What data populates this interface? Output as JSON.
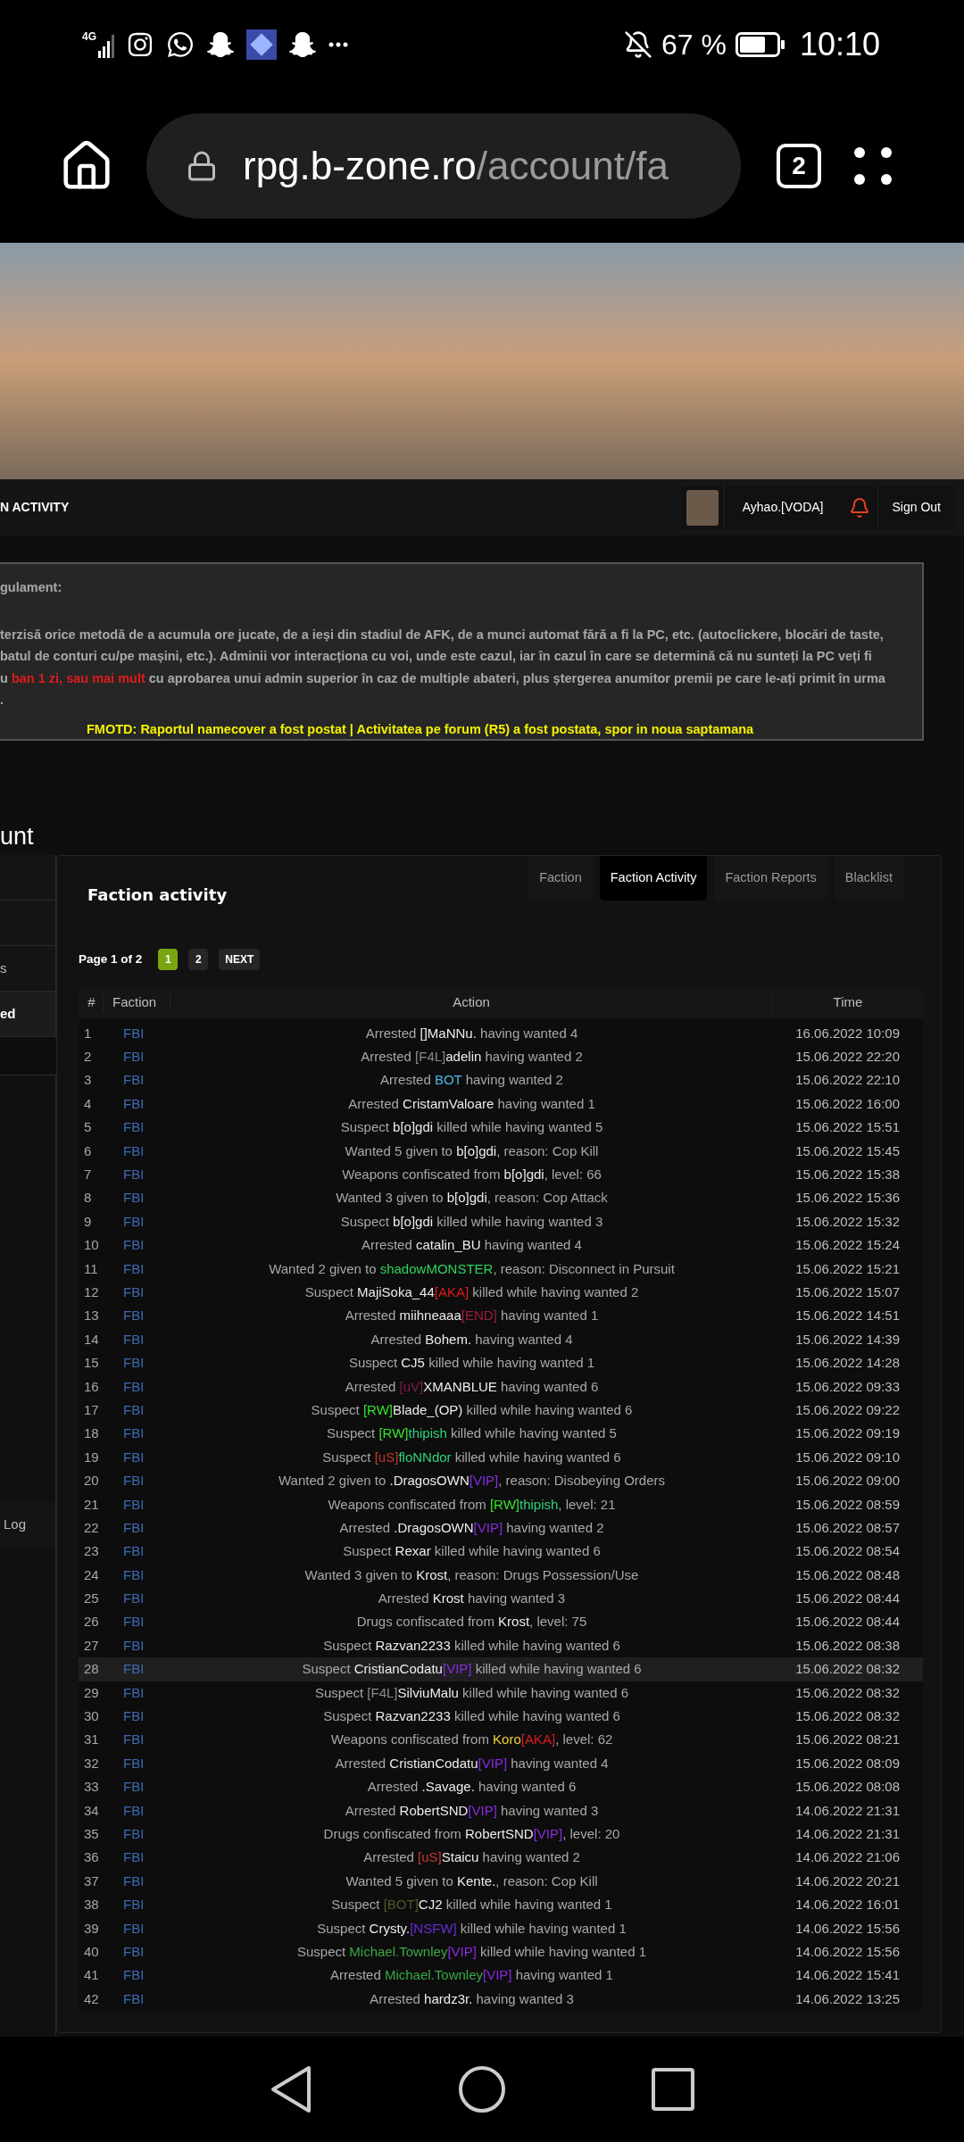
{
  "status_bar": {
    "network": "4G",
    "battery": "67 %",
    "time": "10:10"
  },
  "browser": {
    "url_host": "rpg.b-zone.ro",
    "url_path": "/account/fa",
    "tab_count": "2"
  },
  "nav": {
    "section": "N ACTIVITY",
    "user": "Ayhao.[VODA]",
    "sign_out": "Sign Out"
  },
  "rules": {
    "lines": [
      {
        "kind": "heading",
        "parts": [
          {
            "kind": "text",
            "text": "gulament:"
          }
        ]
      },
      {
        "kind": "body",
        "parts": [
          {
            "kind": "text",
            "text": "terzisă orice metodă de a acumula ore jucate, de a ieși din stadiul de AFK, de a munci automat fără a fi la PC, etc. (autoclickere, blocări de taste,"
          }
        ]
      },
      {
        "kind": "body",
        "parts": [
          {
            "kind": "text",
            "text": "batul de conturi cu/pe mașini, etc.). Adminii vor interacționa cu voi, unde este cazul, iar în cazul în care se determină că nu sunteți la PC veți fi"
          }
        ]
      },
      {
        "kind": "body",
        "parts": [
          {
            "kind": "text",
            "text": "u "
          },
          {
            "kind": "warning",
            "text": "ban 1 zi, sau mai mult"
          },
          {
            "kind": "text",
            "text": " cu aprobarea unui admin superior în caz de multiple abateri, plus ștergerea anumitor premii pe care le-ați primit în urma"
          }
        ]
      },
      {
        "kind": "body",
        "parts": [
          {
            "kind": "text",
            "text": "."
          }
        ]
      }
    ],
    "motd": "FMOTD: Raportul namecover a fost postat | Activitatea pe forum (R5) a fost postata, spor in noua saptamana"
  },
  "page_heading": "unt",
  "sidebar": {
    "items": [
      {
        "label": "s",
        "selected": false
      },
      {
        "label": "ed",
        "selected": true
      }
    ],
    "lower_items": [
      {
        "label": "Log",
        "selected": false
      }
    ]
  },
  "panel": {
    "title": "Faction activity",
    "tabs": [
      {
        "label": "Faction",
        "selected": false
      },
      {
        "label": "Faction Activity",
        "selected": true
      },
      {
        "label": "Faction Reports",
        "selected": false
      },
      {
        "label": "Blacklist",
        "selected": false
      }
    ],
    "pagination": {
      "label": "Page 1 of 2",
      "pages": [
        {
          "label": "1",
          "selected": true
        },
        {
          "label": "2",
          "selected": false
        }
      ],
      "next": "NEXT"
    },
    "table": {
      "columns": [
        "#",
        "Faction",
        "Action",
        "Time"
      ],
      "rows": [
        {
          "n": "1",
          "faction": "FBI",
          "time": "16.06.2022 10:09",
          "highlighted": false,
          "action": [
            {
              "kind": "text",
              "text": "Arrested "
            },
            {
              "kind": "name",
              "text": "[]MaNNu."
            },
            {
              "kind": "text",
              "text": " having wanted 4"
            }
          ]
        },
        {
          "n": "2",
          "faction": "FBI",
          "time": "15.06.2022 22:20",
          "highlighted": false,
          "action": [
            {
              "kind": "text",
              "text": "Arrested "
            },
            {
              "kind": "tag",
              "text": "[F4L]",
              "color": "#8a8a8a"
            },
            {
              "kind": "name",
              "text": "adelin"
            },
            {
              "kind": "text",
              "text": " having wanted 2"
            }
          ]
        },
        {
          "n": "3",
          "faction": "FBI",
          "time": "15.06.2022 22:10",
          "highlighted": false,
          "action": [
            {
              "kind": "text",
              "text": "Arrested "
            },
            {
              "kind": "tag",
              "text": "BOT",
              "color": "#4ab8e8"
            },
            {
              "kind": "text",
              "text": " having wanted 2"
            }
          ]
        },
        {
          "n": "4",
          "faction": "FBI",
          "time": "15.06.2022 16:00",
          "highlighted": false,
          "action": [
            {
              "kind": "text",
              "text": "Arrested "
            },
            {
              "kind": "name",
              "text": "CristamValoare"
            },
            {
              "kind": "text",
              "text": " having wanted 1"
            }
          ]
        },
        {
          "n": "5",
          "faction": "FBI",
          "time": "15.06.2022 15:51",
          "highlighted": false,
          "action": [
            {
              "kind": "text",
              "text": "Suspect "
            },
            {
              "kind": "name",
              "text": "b[o]gdi"
            },
            {
              "kind": "text",
              "text": " killed while having wanted 5"
            }
          ]
        },
        {
          "n": "6",
          "faction": "FBI",
          "time": "15.06.2022 15:45",
          "highlighted": false,
          "action": [
            {
              "kind": "text",
              "text": "Wanted 5 given to "
            },
            {
              "kind": "name",
              "text": "b[o]gdi"
            },
            {
              "kind": "text",
              "text": ", reason: Cop Kill"
            }
          ]
        },
        {
          "n": "7",
          "faction": "FBI",
          "time": "15.06.2022 15:38",
          "highlighted": false,
          "action": [
            {
              "kind": "text",
              "text": "Weapons confiscated from "
            },
            {
              "kind": "name",
              "text": "b[o]gdi"
            },
            {
              "kind": "text",
              "text": ", level: 66"
            }
          ]
        },
        {
          "n": "8",
          "faction": "FBI",
          "time": "15.06.2022 15:36",
          "highlighted": false,
          "action": [
            {
              "kind": "text",
              "text": "Wanted 3 given to "
            },
            {
              "kind": "name",
              "text": "b[o]gdi"
            },
            {
              "kind": "text",
              "text": ", reason: Cop Attack"
            }
          ]
        },
        {
          "n": "9",
          "faction": "FBI",
          "time": "15.06.2022 15:32",
          "highlighted": false,
          "action": [
            {
              "kind": "text",
              "text": "Suspect "
            },
            {
              "kind": "name",
              "text": "b[o]gdi"
            },
            {
              "kind": "text",
              "text": " killed while having wanted 3"
            }
          ]
        },
        {
          "n": "10",
          "faction": "FBI",
          "time": "15.06.2022 15:24",
          "highlighted": false,
          "action": [
            {
              "kind": "text",
              "text": "Arrested "
            },
            {
              "kind": "name",
              "text": "catalin_BU"
            },
            {
              "kind": "text",
              "text": " having wanted 4"
            }
          ]
        },
        {
          "n": "11",
          "faction": "FBI",
          "time": "15.06.2022 15:21",
          "highlighted": false,
          "action": [
            {
              "kind": "text",
              "text": "Wanted 2 given to "
            },
            {
              "kind": "tag",
              "text": "shadowMONSTER",
              "color": "#2fd45a"
            },
            {
              "kind": "text",
              "text": ", reason: Disconnect in Pursuit"
            }
          ]
        },
        {
          "n": "12",
          "faction": "FBI",
          "time": "15.06.2022 15:07",
          "highlighted": false,
          "action": [
            {
              "kind": "text",
              "text": "Suspect "
            },
            {
              "kind": "name",
              "text": "MajiSoka_44"
            },
            {
              "kind": "tag",
              "text": "[AKA]",
              "color": "#e01b1b"
            },
            {
              "kind": "text",
              "text": " killed while having wanted 2"
            }
          ]
        },
        {
          "n": "13",
          "faction": "FBI",
          "time": "15.06.2022 14:51",
          "highlighted": false,
          "action": [
            {
              "kind": "text",
              "text": "Arrested "
            },
            {
              "kind": "name",
              "text": "miihneaaa"
            },
            {
              "kind": "tag",
              "text": "[END]",
              "color": "#9c1f3c"
            },
            {
              "kind": "text",
              "text": " having wanted 1"
            }
          ]
        },
        {
          "n": "14",
          "faction": "FBI",
          "time": "15.06.2022 14:39",
          "highlighted": false,
          "action": [
            {
              "kind": "text",
              "text": "Arrested "
            },
            {
              "kind": "name",
              "text": "Bohem."
            },
            {
              "kind": "text",
              "text": " having wanted 4"
            }
          ]
        },
        {
          "n": "15",
          "faction": "FBI",
          "time": "15.06.2022 14:28",
          "highlighted": false,
          "action": [
            {
              "kind": "text",
              "text": "Suspect "
            },
            {
              "kind": "name",
              "text": "CJ5"
            },
            {
              "kind": "text",
              "text": " killed while having wanted 1"
            }
          ]
        },
        {
          "n": "16",
          "faction": "FBI",
          "time": "15.06.2022 09:33",
          "highlighted": false,
          "action": [
            {
              "kind": "text",
              "text": "Arrested "
            },
            {
              "kind": "tag",
              "text": "[uV]",
              "color": "#7d1f4c"
            },
            {
              "kind": "name",
              "text": "XMANBLUE"
            },
            {
              "kind": "text",
              "text": " having wanted 6"
            }
          ]
        },
        {
          "n": "17",
          "faction": "FBI",
          "time": "15.06.2022 09:22",
          "highlighted": false,
          "action": [
            {
              "kind": "text",
              "text": "Suspect "
            },
            {
              "kind": "tag",
              "text": "[RW]",
              "color": "#33e62b"
            },
            {
              "kind": "name",
              "text": "Blade_(OP)"
            },
            {
              "kind": "text",
              "text": " killed while having wanted 6"
            }
          ]
        },
        {
          "n": "18",
          "faction": "FBI",
          "time": "15.06.2022 09:19",
          "highlighted": false,
          "action": [
            {
              "kind": "text",
              "text": "Suspect "
            },
            {
              "kind": "tag",
              "text": "[RW]",
              "color": "#33e62b"
            },
            {
              "kind": "tag",
              "text": "thipish",
              "color": "#2fd47a"
            },
            {
              "kind": "text",
              "text": " killed while having wanted 5"
            }
          ]
        },
        {
          "n": "19",
          "faction": "FBI",
          "time": "15.06.2022 09:10",
          "highlighted": false,
          "action": [
            {
              "kind": "text",
              "text": "Suspect "
            },
            {
              "kind": "tag",
              "text": "[uS]",
              "color": "#c8382c"
            },
            {
              "kind": "tag",
              "text": "floNNdor",
              "color": "#2fd47a"
            },
            {
              "kind": "text",
              "text": " killed while having wanted 6"
            }
          ]
        },
        {
          "n": "20",
          "faction": "FBI",
          "time": "15.06.2022 09:00",
          "highlighted": false,
          "action": [
            {
              "kind": "text",
              "text": "Wanted 2 given to "
            },
            {
              "kind": "name",
              "text": ".DragosOWN"
            },
            {
              "kind": "tag",
              "text": "[VIP]",
              "color": "#8a2be2"
            },
            {
              "kind": "text",
              "text": ", reason: Disobeying Orders"
            }
          ]
        },
        {
          "n": "21",
          "faction": "FBI",
          "time": "15.06.2022 08:59",
          "highlighted": false,
          "action": [
            {
              "kind": "text",
              "text": "Weapons confiscated from "
            },
            {
              "kind": "tag",
              "text": "[RW]",
              "color": "#33e62b"
            },
            {
              "kind": "tag",
              "text": "thipish",
              "color": "#2fd47a"
            },
            {
              "kind": "text",
              "text": ", level: 21"
            }
          ]
        },
        {
          "n": "22",
          "faction": "FBI",
          "time": "15.06.2022 08:57",
          "highlighted": false,
          "action": [
            {
              "kind": "text",
              "text": "Arrested "
            },
            {
              "kind": "name",
              "text": ".DragosOWN"
            },
            {
              "kind": "tag",
              "text": "[VIP]",
              "color": "#8a2be2"
            },
            {
              "kind": "text",
              "text": " having wanted 2"
            }
          ]
        },
        {
          "n": "23",
          "faction": "FBI",
          "time": "15.06.2022 08:54",
          "highlighted": false,
          "action": [
            {
              "kind": "text",
              "text": "Suspect "
            },
            {
              "kind": "name",
              "text": "Rexar"
            },
            {
              "kind": "text",
              "text": " killed while having wanted 6"
            }
          ]
        },
        {
          "n": "24",
          "faction": "FBI",
          "time": "15.06.2022 08:48",
          "highlighted": false,
          "action": [
            {
              "kind": "text",
              "text": "Wanted 3 given to "
            },
            {
              "kind": "name",
              "text": "Krost"
            },
            {
              "kind": "text",
              "text": ", reason: Drugs Possession/Use"
            }
          ]
        },
        {
          "n": "25",
          "faction": "FBI",
          "time": "15.06.2022 08:44",
          "highlighted": false,
          "action": [
            {
              "kind": "text",
              "text": "Arrested "
            },
            {
              "kind": "name",
              "text": "Krost"
            },
            {
              "kind": "text",
              "text": " having wanted 3"
            }
          ]
        },
        {
          "n": "26",
          "faction": "FBI",
          "time": "15.06.2022 08:44",
          "highlighted": false,
          "action": [
            {
              "kind": "text",
              "text": "Drugs confiscated from "
            },
            {
              "kind": "name",
              "text": "Krost"
            },
            {
              "kind": "text",
              "text": ", level: 75"
            }
          ]
        },
        {
          "n": "27",
          "faction": "FBI",
          "time": "15.06.2022 08:38",
          "highlighted": false,
          "action": [
            {
              "kind": "text",
              "text": "Suspect "
            },
            {
              "kind": "name",
              "text": "Razvan2233"
            },
            {
              "kind": "text",
              "text": " killed while having wanted 6"
            }
          ]
        },
        {
          "n": "28",
          "faction": "FBI",
          "time": "15.06.2022 08:32",
          "highlighted": true,
          "action": [
            {
              "kind": "text",
              "text": "Suspect "
            },
            {
              "kind": "name",
              "text": "CristianCodatu"
            },
            {
              "kind": "tag",
              "text": "[VIP]",
              "color": "#8a2be2"
            },
            {
              "kind": "text",
              "text": " killed while having wanted 6"
            }
          ]
        },
        {
          "n": "29",
          "faction": "FBI",
          "time": "15.06.2022 08:32",
          "highlighted": false,
          "action": [
            {
              "kind": "text",
              "text": "Suspect "
            },
            {
              "kind": "tag",
              "text": "[F4L]",
              "color": "#8a8a8a"
            },
            {
              "kind": "name",
              "text": "SilviuMalu"
            },
            {
              "kind": "text",
              "text": " killed while having wanted 6"
            }
          ]
        },
        {
          "n": "30",
          "faction": "FBI",
          "time": "15.06.2022 08:32",
          "highlighted": false,
          "action": [
            {
              "kind": "text",
              "text": "Suspect "
            },
            {
              "kind": "name",
              "text": "Razvan2233"
            },
            {
              "kind": "text",
              "text": " killed while having wanted 6"
            }
          ]
        },
        {
          "n": "31",
          "faction": "FBI",
          "time": "15.06.2022 08:21",
          "highlighted": false,
          "action": [
            {
              "kind": "text",
              "text": "Weapons confiscated from "
            },
            {
              "kind": "tag",
              "text": "Koro",
              "color": "#f2d33a"
            },
            {
              "kind": "tag",
              "text": "[AKA]",
              "color": "#e01b1b"
            },
            {
              "kind": "text",
              "text": ", level: 62"
            }
          ]
        },
        {
          "n": "32",
          "faction": "FBI",
          "time": "15.06.2022 08:09",
          "highlighted": false,
          "action": [
            {
              "kind": "text",
              "text": "Arrested "
            },
            {
              "kind": "name",
              "text": "CristianCodatu"
            },
            {
              "kind": "tag",
              "text": "[VIP]",
              "color": "#8a2be2"
            },
            {
              "kind": "text",
              "text": " having wanted 4"
            }
          ]
        },
        {
          "n": "33",
          "faction": "FBI",
          "time": "15.06.2022 08:08",
          "highlighted": false,
          "action": [
            {
              "kind": "text",
              "text": "Arrested "
            },
            {
              "kind": "name",
              "text": ".Savage."
            },
            {
              "kind": "text",
              "text": " having wanted 6"
            }
          ]
        },
        {
          "n": "34",
          "faction": "FBI",
          "time": "14.06.2022 21:31",
          "highlighted": false,
          "action": [
            {
              "kind": "text",
              "text": "Arrested "
            },
            {
              "kind": "name",
              "text": "RobertSND"
            },
            {
              "kind": "tag",
              "text": "[VIP]",
              "color": "#8a2be2"
            },
            {
              "kind": "text",
              "text": " having wanted 3"
            }
          ]
        },
        {
          "n": "35",
          "faction": "FBI",
          "time": "14.06.2022 21:31",
          "highlighted": false,
          "action": [
            {
              "kind": "text",
              "text": "Drugs confiscated from "
            },
            {
              "kind": "name",
              "text": "RobertSND"
            },
            {
              "kind": "tag",
              "text": "[VIP]",
              "color": "#8a2be2"
            },
            {
              "kind": "text",
              "text": ", level: 20"
            }
          ]
        },
        {
          "n": "36",
          "faction": "FBI",
          "time": "14.06.2022 21:06",
          "highlighted": false,
          "action": [
            {
              "kind": "text",
              "text": "Arrested "
            },
            {
              "kind": "tag",
              "text": "[uS]",
              "color": "#c8382c"
            },
            {
              "kind": "name",
              "text": "Staicu"
            },
            {
              "kind": "text",
              "text": " having wanted 2"
            }
          ]
        },
        {
          "n": "37",
          "faction": "FBI",
          "time": "14.06.2022 20:21",
          "highlighted": false,
          "action": [
            {
              "kind": "text",
              "text": "Wanted 5 given to "
            },
            {
              "kind": "name",
              "text": "Kente."
            },
            {
              "kind": "text",
              "text": ", reason: Cop Kill"
            }
          ]
        },
        {
          "n": "38",
          "faction": "FBI",
          "time": "14.06.2022 16:01",
          "highlighted": false,
          "action": [
            {
              "kind": "text",
              "text": "Suspect "
            },
            {
              "kind": "tag",
              "text": "[BOT]",
              "color": "#4d5a2a"
            },
            {
              "kind": "name",
              "text": "CJ2"
            },
            {
              "kind": "text",
              "text": " killed while having wanted 1"
            }
          ]
        },
        {
          "n": "39",
          "faction": "FBI",
          "time": "14.06.2022 15:56",
          "highlighted": false,
          "action": [
            {
              "kind": "text",
              "text": "Suspect "
            },
            {
              "kind": "name",
              "text": "Crysty."
            },
            {
              "kind": "tag",
              "text": "[NSFW]",
              "color": "#6a2bd6"
            },
            {
              "kind": "text",
              "text": " killed while having wanted 1"
            }
          ]
        },
        {
          "n": "40",
          "faction": "FBI",
          "time": "14.06.2022 15:56",
          "highlighted": false,
          "action": [
            {
              "kind": "text",
              "text": "Suspect "
            },
            {
              "kind": "tag",
              "text": "Michael.Townley",
              "color": "#3aa845"
            },
            {
              "kind": "tag",
              "text": "[VIP]",
              "color": "#8a2be2"
            },
            {
              "kind": "text",
              "text": " killed while having wanted 1"
            }
          ]
        },
        {
          "n": "41",
          "faction": "FBI",
          "time": "14.06.2022 15:41",
          "highlighted": false,
          "action": [
            {
              "kind": "text",
              "text": "Arrested "
            },
            {
              "kind": "tag",
              "text": "Michael.Townley",
              "color": "#3aa845"
            },
            {
              "kind": "tag",
              "text": "[VIP]",
              "color": "#8a2be2"
            },
            {
              "kind": "text",
              "text": " having wanted 1"
            }
          ]
        },
        {
          "n": "42",
          "faction": "FBI",
          "time": "14.06.2022 13:25",
          "highlighted": false,
          "action": [
            {
              "kind": "text",
              "text": "Arrested "
            },
            {
              "kind": "name",
              "text": "hardz3r."
            },
            {
              "kind": "text",
              "text": " having wanted 3"
            }
          ]
        }
      ]
    }
  }
}
